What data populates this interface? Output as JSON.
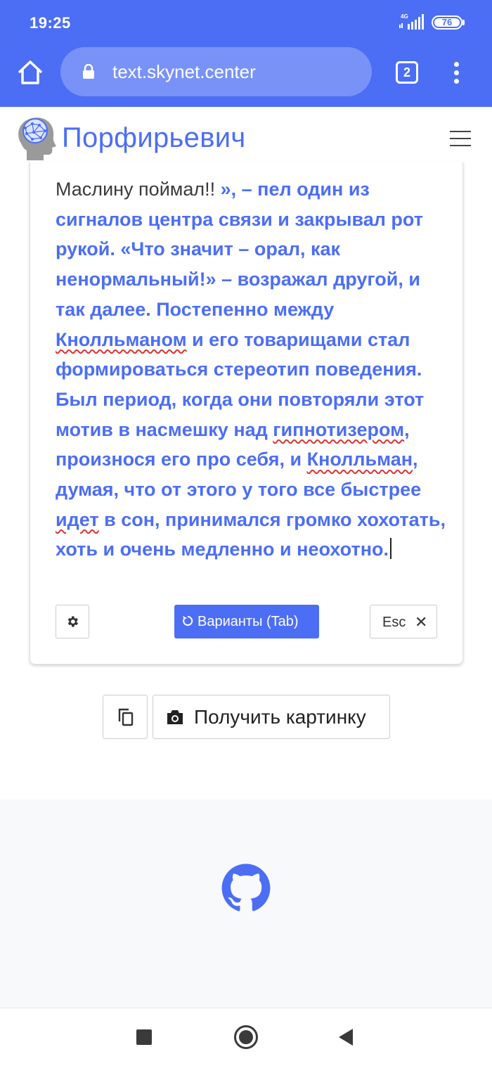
{
  "status_bar": {
    "time": "19:25",
    "network": "4G",
    "battery": "76"
  },
  "browser": {
    "url": "text.skynet.center",
    "tab_count": "2"
  },
  "site": {
    "brand": "Порфирьевич"
  },
  "editor": {
    "segments": [
      {
        "text": "Маслину поймал!! ",
        "kind": "given"
      },
      {
        "text": "», – пел один из сигналов центра связи и закрывал рот рукой. «Что значит – орал, как ненормальный!» – возражал другой, и так далее. Постепенно между ",
        "kind": "gen"
      },
      {
        "text": "Кнолльманом",
        "kind": "gen-spell"
      },
      {
        "text": " и его товарищами стал формироваться стереотип поведения. Был период, когда они повторяли этот мотив в насмешку над ",
        "kind": "gen"
      },
      {
        "text": "гипнотизером",
        "kind": "gen-spell"
      },
      {
        "text": ", произнося его про себя, и ",
        "kind": "gen"
      },
      {
        "text": "Кнолльман",
        "kind": "gen-spell"
      },
      {
        "text": ", думая, что от этого у того все быстрее ",
        "kind": "gen"
      },
      {
        "text": "идет",
        "kind": "gen-spell"
      },
      {
        "text": " в сон, принимался громко хохотать, хоть и очень медленно и неохотно.",
        "kind": "gen"
      }
    ],
    "variants_label": "Варианты (Tab)",
    "esc_label": "Esc",
    "esc_symbol": "✕"
  },
  "actions": {
    "screenshot_label": "Получить картинку"
  },
  "colors": {
    "accent": "#4c6ef5",
    "spellcheck": "#e03131"
  },
  "icons": [
    "home-icon",
    "lock-icon",
    "tabs-icon",
    "menu-dots-icon",
    "hamburger-icon",
    "gear-icon",
    "refresh-icon",
    "close-icon",
    "copy-icon",
    "camera-icon",
    "github-icon"
  ]
}
